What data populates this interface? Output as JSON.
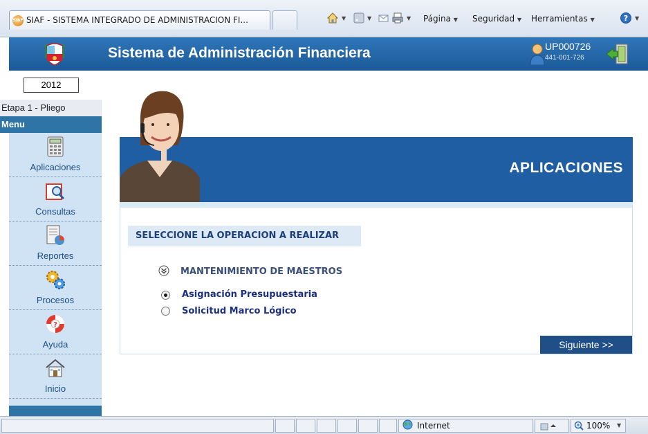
{
  "browser": {
    "tab_title": "SIAF - SISTEMA INTEGRADO DE ADMINISTRACION FI...",
    "tab_icon_text": "SIAF",
    "menu": {
      "page": "Página",
      "security": "Seguridad",
      "tools": "Herramientas"
    }
  },
  "header": {
    "title": "Sistema de Administración Financiera",
    "user_id": "UP000726",
    "user_code": "441-001-726"
  },
  "sidebar": {
    "year": "2012",
    "stage": "Etapa 1 - Pliego",
    "menu_title": "Menu",
    "items": [
      {
        "label": "Aplicaciones",
        "icon": "calculator-icon"
      },
      {
        "label": "Consultas",
        "icon": "magnifier-icon"
      },
      {
        "label": "Reportes",
        "icon": "report-chart-icon"
      },
      {
        "label": "Procesos",
        "icon": "gears-icon"
      },
      {
        "label": "Ayuda",
        "icon": "lifebuoy-icon"
      },
      {
        "label": "Inicio",
        "icon": "home-icon"
      }
    ]
  },
  "main": {
    "banner_title": "APLICACIONES",
    "section_title": "SELECCIONE LA OPERACION A REALIZAR",
    "group_label": "MANTENIMIENTO DE MAESTROS",
    "options": [
      {
        "label": "Asignación Presupuestaria",
        "selected": true
      },
      {
        "label": "Solicitud Marco Lógico",
        "selected": false
      }
    ],
    "next_button": "Siguiente >>"
  },
  "status": {
    "zone": "Internet",
    "zoom": "100%"
  },
  "colors": {
    "header_blue": "#1c5a98",
    "banner_blue": "#1f5ea3",
    "sidebar_bg": "#cfe3f4",
    "link_blue": "#1c2f80"
  }
}
